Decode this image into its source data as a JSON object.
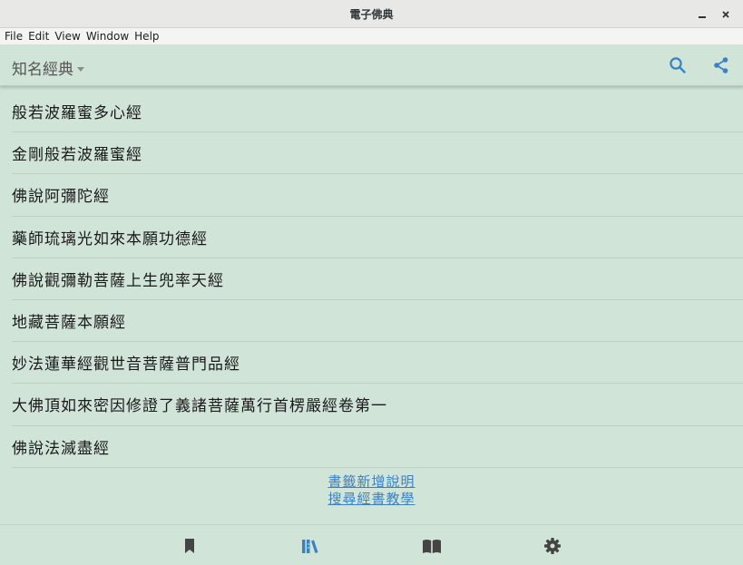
{
  "window": {
    "title": "電子佛典"
  },
  "menu": [
    "File",
    "Edit",
    "View",
    "Window",
    "Help"
  ],
  "appbar": {
    "category": "知名經典"
  },
  "sutras": [
    "般若波羅蜜多心經",
    "金剛般若波羅蜜經",
    "佛說阿彌陀經",
    "藥師琉璃光如來本願功德經",
    "佛說觀彌勒菩薩上生兜率天經",
    "地藏菩薩本願經",
    "妙法蓮華經觀世音菩薩普門品經",
    "大佛頂如來密因修證了義諸菩薩萬行首楞嚴經卷第一",
    "佛說法滅盡經"
  ],
  "links": {
    "bookmark_help": "書籤新增說明",
    "search_tutorial": "搜尋經書教學"
  },
  "colors": {
    "background": "#d1e4d8",
    "accent": "#3a82c4",
    "nav_active": "#3a82c4",
    "nav_inactive": "#444444"
  }
}
